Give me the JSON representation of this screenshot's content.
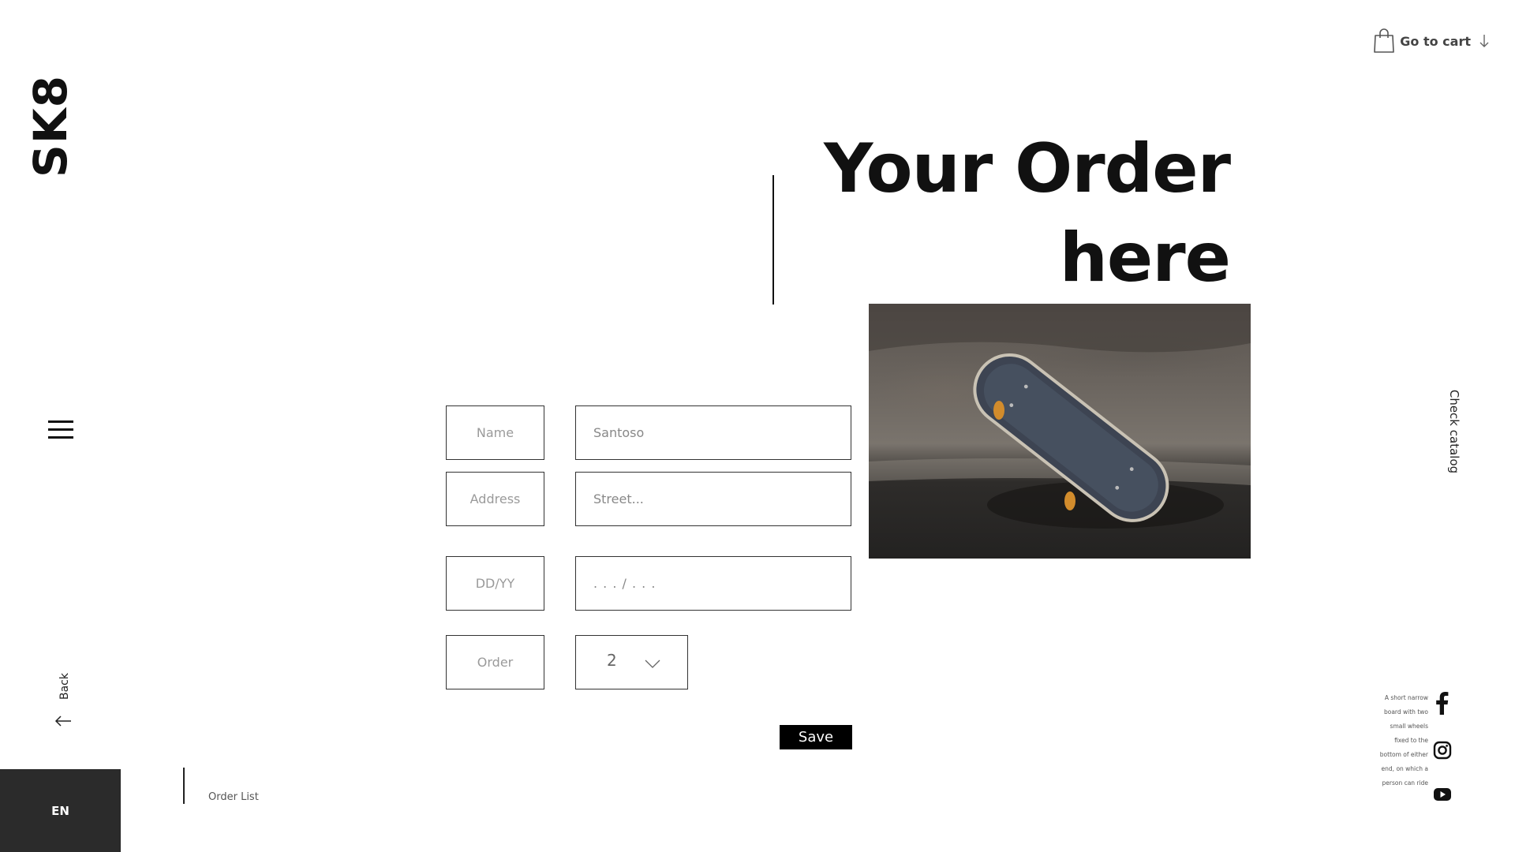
{
  "brand": {
    "logo": "SK8"
  },
  "header": {
    "cart_label": "Go to cart"
  },
  "hero": {
    "title_line1": "Your Order",
    "title_line2": "here"
  },
  "form": {
    "name_label": "Name",
    "name_value": "Santoso",
    "address_label": "Address",
    "address_placeholder": "Street...",
    "date_label": "DD/YY",
    "date_placeholder": ". . . / . . .",
    "order_label": "Order",
    "order_value": "2",
    "save_label": "Save"
  },
  "side": {
    "catalog_label": "Check catalog",
    "back_label": "Back",
    "lang": "EN",
    "order_list": "Order List"
  },
  "blurb_lines": [
    "A short narrow",
    "board with two",
    "small wheels",
    "fixed to the",
    "bottom of either",
    "end, on which a",
    "person can ride"
  ],
  "social": [
    "facebook-icon",
    "instagram-icon",
    "youtube-icon"
  ]
}
